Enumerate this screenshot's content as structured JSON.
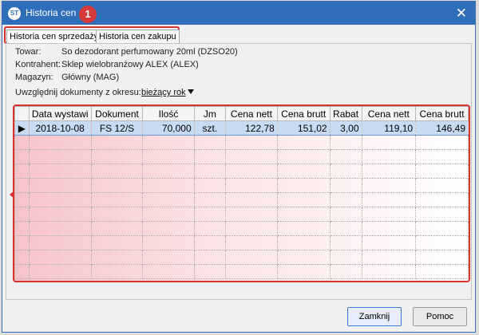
{
  "window": {
    "title": "Historia cen",
    "badge": "1",
    "close": "✕",
    "app_icon_text": "ST"
  },
  "tabs": [
    {
      "label": "Historia cen sprzedaży",
      "active": true
    },
    {
      "label": "Historia cen zakupu",
      "active": false
    }
  ],
  "info": {
    "towar_label": "Towar:",
    "towar_value": "So dezodorant perfumowany 20ml (DZSO20)",
    "kontrahent_label": "Kontrahent:",
    "kontrahent_value": "Sklep wielobranżowy ALEX (ALEX)",
    "magazyn_label": "Magazyn:",
    "magazyn_value": "Główny (MAG)",
    "period_label": "Uwzględnij dokumenty z okresu:",
    "period_value": "bieżący rok"
  },
  "table": {
    "columns": [
      "Data wystawi",
      "Dokument",
      "Ilość",
      "Jm",
      "Cena nett",
      "Cena brutt",
      "Rabat",
      "Cena nett",
      "Cena brutt"
    ],
    "rows": [
      {
        "data": "2018-10-08",
        "dokument": "FS 12/S",
        "ilosc": "70,000",
        "jm": "szt.",
        "cena_nett1": "122,78",
        "cena_brutt1": "151,02",
        "rabat": "3,00",
        "cena_nett2": "119,10",
        "cena_brutt2": "146,49"
      }
    ]
  },
  "buttons": {
    "close_label": "Zamknij",
    "help_label": "Pomoc"
  },
  "colors": {
    "titlebar": "#2f6fba",
    "annotation": "#d93030",
    "selected_row": "#c8dbf2"
  }
}
